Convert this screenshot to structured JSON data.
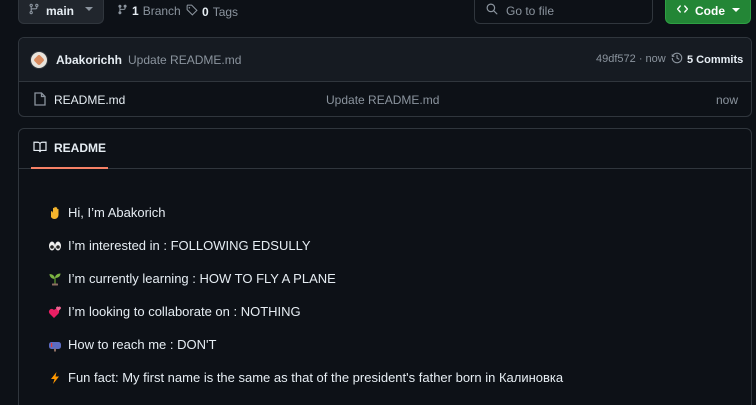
{
  "branch": {
    "name": "main",
    "icon": "git-branch-icon"
  },
  "branches": {
    "count": "1",
    "label": "Branch"
  },
  "tags": {
    "count": "0",
    "label": "Tags"
  },
  "search": {
    "placeholder": "Go to file"
  },
  "code_button": {
    "label": "Code"
  },
  "commit": {
    "author": "Abakorichh",
    "message": "Update README.md",
    "hash_time": "49df572 · now",
    "commits_count": "5 Commits"
  },
  "files": [
    {
      "name": "README.md",
      "message": "Update README.md",
      "time": "now"
    }
  ],
  "readme": {
    "tab_label": "README",
    "lines": [
      {
        "icon": "waving-hand-emoji",
        "text": "Hi, I’m Abakorich"
      },
      {
        "icon": "eyes-emoji",
        "text": "I’m interested in : FOLLOWING EDSULLY"
      },
      {
        "icon": "seedling-emoji",
        "text": "I’m currently learning : HOW TO FLY A PLANE"
      },
      {
        "icon": "revolving-hearts-emoji",
        "text": "I’m looking to collaborate on : NOTHING"
      },
      {
        "icon": "mailbox-emoji",
        "text": "How to reach me : DON'T"
      },
      {
        "icon": "high-voltage-emoji",
        "text": "Fun fact: My first name is the same as that of the president's father born in Калиновка"
      }
    ]
  },
  "colors": {
    "background": "#0d1117",
    "border": "#30363d",
    "muted_text": "#8b949e",
    "code_button": "#238636",
    "tab_underline": "#f78166"
  }
}
